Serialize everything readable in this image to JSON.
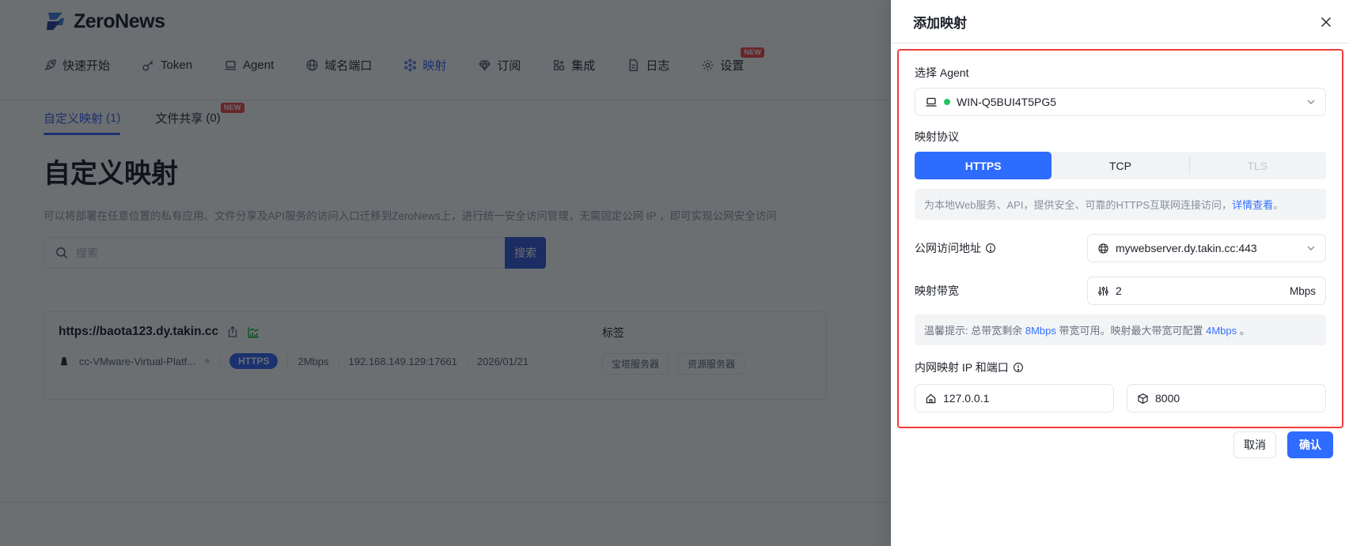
{
  "brand": {
    "name": "ZeroNews"
  },
  "nav": {
    "items": [
      {
        "label": "快速开始",
        "icon": "rocket-icon"
      },
      {
        "label": "Token",
        "icon": "key-icon"
      },
      {
        "label": "Agent",
        "icon": "laptop-icon"
      },
      {
        "label": "域名端口",
        "icon": "globe-icon"
      },
      {
        "label": "映射",
        "icon": "nodes-icon",
        "active": true
      },
      {
        "label": "订阅",
        "icon": "gem-icon"
      },
      {
        "label": "集成",
        "icon": "blocks-icon"
      },
      {
        "label": "日志",
        "icon": "document-icon"
      },
      {
        "label": "设置",
        "icon": "gear-icon",
        "badge": "NEW"
      }
    ]
  },
  "tabs": [
    {
      "label": "自定义映射",
      "count": "(1)",
      "active": true
    },
    {
      "label": "文件共享",
      "count": "(0)",
      "badge": "NEW"
    }
  ],
  "page": {
    "title": "自定义映射",
    "description": "可以将部署在任意位置的私有应用、文件分享及API服务的访问入口迁移到ZeroNews上，进行统一安全访问管理，无需固定公网 IP ，即可实现公网安全访问",
    "search_placeholder": "搜索",
    "search_button": "搜索"
  },
  "mapping_card": {
    "url": "https://baota123.dy.takin.cc",
    "agent_name": "cc-VMware-Virtual-Platf...",
    "protocol_badge": "HTTPS",
    "bandwidth": "2Mbps",
    "endpoint": "192.168.149.129:17661",
    "expire_date": "2026/01/21",
    "tags_label": "标签",
    "tags": [
      {
        "label": "宝塔服务器"
      },
      {
        "label": "资源服务器"
      }
    ]
  },
  "drawer": {
    "title": "添加映射",
    "agent_label": "选择 Agent",
    "agent_value": "WIN-Q5BUI4T5PG5",
    "protocol_label": "映射协议",
    "protocols": [
      {
        "label": "HTTPS"
      },
      {
        "label": "TCP"
      },
      {
        "label": "TLS"
      }
    ],
    "protocol_hint": {
      "text": "为本地Web服务、API，提供安全、可靠的HTTPS互联网连接访问，",
      "link": "详情查看",
      "suffix": "。"
    },
    "public_address_label": "公网访问地址",
    "public_address_value": "mywebserver.dy.takin.cc:443",
    "bandwidth_label": "映射带宽",
    "bandwidth_value": "2",
    "bandwidth_unit": "Mbps",
    "bandwidth_tip": {
      "prefix": "温馨提示: 总带宽剩余 ",
      "remain": "8Mbps",
      "middle": " 带宽可用。映射最大带宽可配置 ",
      "max": "4Mbps",
      "suffix": " 。"
    },
    "internal_label": "内网映射 IP 和端口",
    "internal_ip": "127.0.0.1",
    "internal_port": "8000",
    "cancel_button": "取消",
    "confirm_button": "确认"
  },
  "icons": {
    "logo": "lightning-bolt",
    "search": "magnifier",
    "share": "export-arrow",
    "traffic": "green-bar-chart",
    "agent_status": "green-dot",
    "close": "x-mark",
    "info": "circle-exclamation",
    "public_address": "www-globe",
    "bandwidth": "sliders",
    "internal_ip": "home",
    "internal_port": "cube"
  },
  "colors": {
    "accent_blue": "#2E5CF6",
    "segment_blue": "#2E6BFF",
    "link_blue": "#3370FF",
    "highlight_red": "#F23C3C",
    "badge_red": "#F53F3F",
    "success_green": "#22C55E",
    "text_dark": "#1D2129",
    "text_gray": "#86909C",
    "border_gray": "#E5E6EB"
  }
}
